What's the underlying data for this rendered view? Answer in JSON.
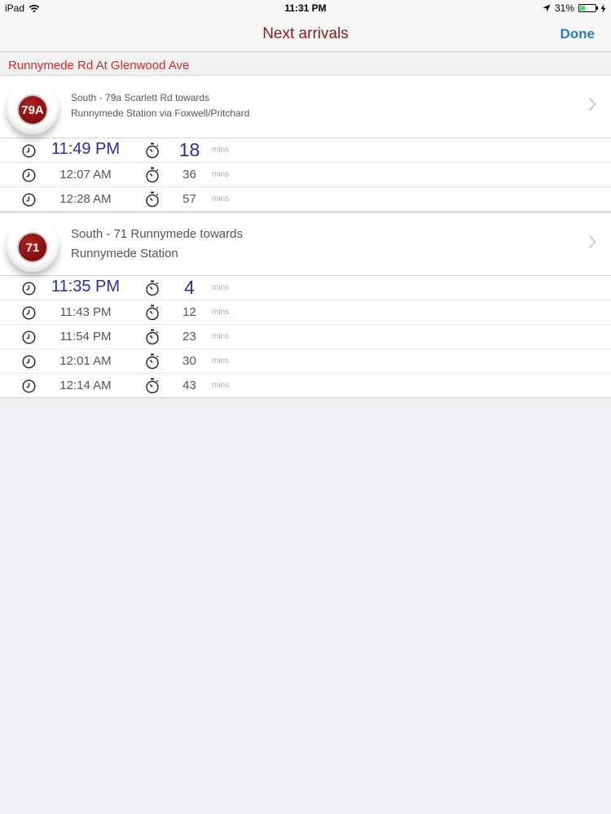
{
  "status_bar": {
    "device": "iPad",
    "time": "11:31 PM",
    "battery": "31%",
    "battery_level": 0.31,
    "wifi_icon": "wifi-icon",
    "location_icon": "location-arrow-icon",
    "charging_icon": "charging-bolt-icon"
  },
  "nav": {
    "title": "Next arrivals",
    "done_label": "Done"
  },
  "section": {
    "title": "Runnymede Rd At Glenwood Ave"
  },
  "routes": [
    {
      "badge": "79A",
      "line1": "South - 79a Scarlett Rd towards",
      "line2": "Runnymede Station via Foxwell/Pritchard",
      "arrivals": [
        {
          "time": "11:49 PM",
          "minutes": "18",
          "unit": "mins"
        },
        {
          "time": "12:07 AM",
          "minutes": "36",
          "unit": "mins"
        },
        {
          "time": "12:28 AM",
          "minutes": "57",
          "unit": "mins"
        }
      ]
    },
    {
      "badge": "71",
      "line1": "South - 71 Runnymede towards",
      "line2": "Runnymede Station",
      "arrivals": [
        {
          "time": "11:35 PM",
          "minutes": "4",
          "unit": "mins"
        },
        {
          "time": "11:43 PM",
          "minutes": "12",
          "unit": "mins"
        },
        {
          "time": "11:54 PM",
          "minutes": "23",
          "unit": "mins"
        },
        {
          "time": "12:01 AM",
          "minutes": "30",
          "unit": "mins"
        },
        {
          "time": "12:14 AM",
          "minutes": "43",
          "unit": "mins"
        }
      ]
    }
  ],
  "colors": {
    "nav_title": "#8c1c1c",
    "done": "#2a7cc2",
    "section_title": "#d22a2a",
    "highlight_time": "#2b2d9c",
    "badge": "#8a0f0f"
  }
}
